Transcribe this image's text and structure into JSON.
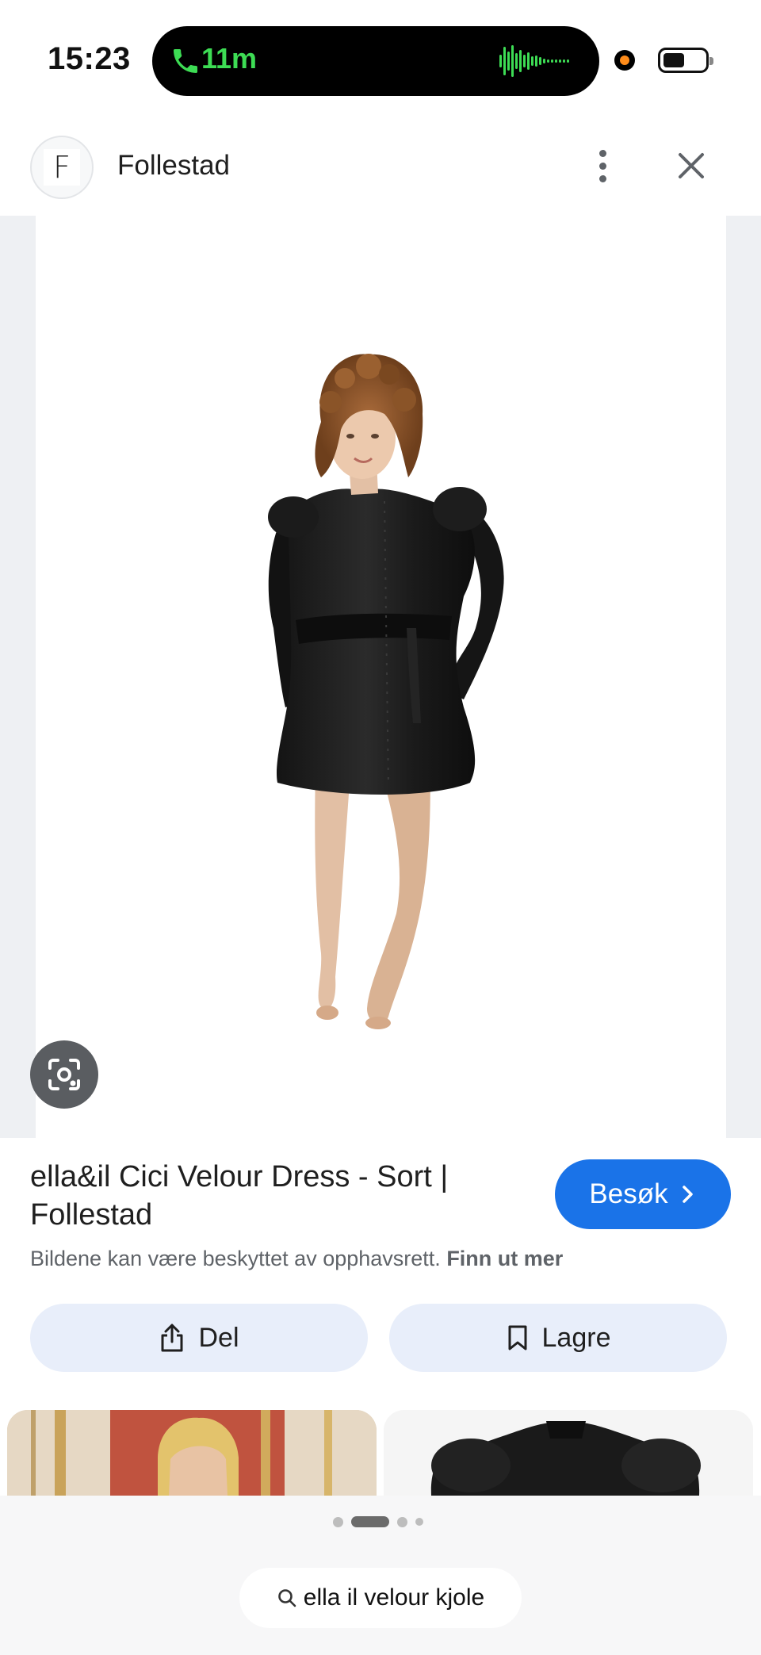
{
  "status_bar": {
    "time": "15:23",
    "call_duration": "11m"
  },
  "header": {
    "site_initial": "F",
    "site_name": "Follestad"
  },
  "viewer": {
    "image_description_icon": "dress-photo"
  },
  "info": {
    "title": "ella&il Cici Velour Dress - Sort | Follestad",
    "visit_label": "Besøk",
    "copyright_notice": "Bildene kan være beskyttet av opphavsrett.",
    "learn_more": "Finn ut mer"
  },
  "actions": {
    "share_label": "Del",
    "save_label": "Lagre"
  },
  "bottom": {
    "search_query": "ella il velour kjole"
  },
  "colors": {
    "accent": "#1a73e8",
    "call_green": "#3ddc54",
    "action_bg": "#e8eefa"
  }
}
